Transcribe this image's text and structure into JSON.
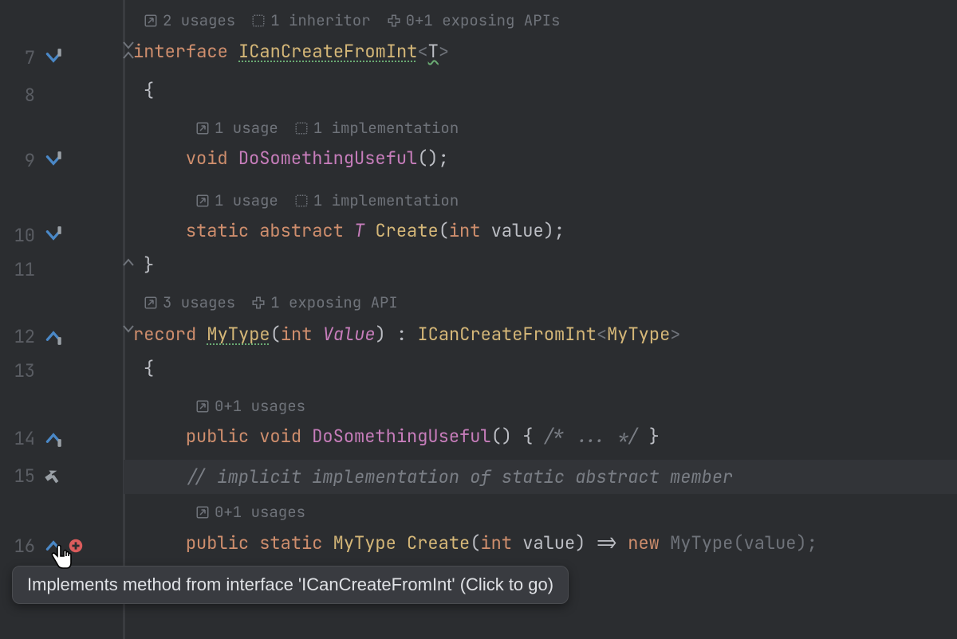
{
  "lines": {
    "7": {
      "num": "7"
    },
    "8": {
      "num": "8"
    },
    "9": {
      "num": "9"
    },
    "10": {
      "num": "10"
    },
    "11": {
      "num": "11"
    },
    "12": {
      "num": "12"
    },
    "13": {
      "num": "13"
    },
    "14": {
      "num": "14"
    },
    "15": {
      "num": "15"
    },
    "16": {
      "num": "16"
    }
  },
  "hints": {
    "iface": {
      "usages": "2 usages",
      "inheritor": "1 inheritor",
      "api": "0+1 exposing APIs"
    },
    "useful": {
      "usages": "1 usage",
      "impl": "1 implementation"
    },
    "create": {
      "usages": "1 usage",
      "impl": "1 implementation"
    },
    "record": {
      "usages": "3 usages",
      "api": "1 exposing API"
    },
    "useful2": {
      "usages": "0+1 usages"
    },
    "create2": {
      "usages": "0+1 usages"
    }
  },
  "code": {
    "l7": {
      "kw": "interface",
      "name": "ICanCreateFromInt",
      "lt": "<",
      "tp": "T",
      "gt": ">"
    },
    "l8": {
      "brace": "{"
    },
    "l9": {
      "kw": "void",
      "name": "DoSomethingUseful",
      "rest": "();"
    },
    "l10": {
      "kw1": "static",
      "kw2": "abstract",
      "ret": "T",
      "name": "Create",
      "open": "(",
      "ptype": "int",
      "pname": "value",
      "close": ");"
    },
    "l11": {
      "brace": "}"
    },
    "l12": {
      "kw": "record",
      "name": "MyType",
      "open": "(",
      "ptype": "int",
      "pname": "Value",
      "close": ")",
      "colon": " : ",
      "base": "ICanCreateFromInt",
      "lt": "<",
      "targ": "MyType",
      "gt": ">"
    },
    "l13": {
      "brace": "{"
    },
    "l14": {
      "kw1": "public",
      "kw2": "void",
      "name": "DoSomethingUseful",
      "rest": "() { ",
      "comment": "/* ... */",
      "end": " }"
    },
    "l15": {
      "comment": "// implicit implementation of static abstract member"
    },
    "l16": {
      "kw1": "public",
      "kw2": "static",
      "ret": "MyType",
      "name": "Create",
      "open": "(",
      "ptype": "int",
      "pname": "value",
      "close": ") => ",
      "newkw": "new",
      "ctor": "MyType",
      "copen": "(",
      "arg": "value",
      "cclose": ");"
    }
  },
  "tooltip": {
    "text": "Implements method from interface 'ICanCreateFromInt' (Click to go)"
  }
}
